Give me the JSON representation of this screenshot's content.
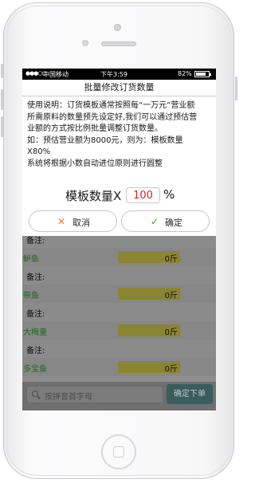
{
  "status_bar": {
    "carrier": "中国移动",
    "time": "下午3:59",
    "battery_percent": "82%",
    "battery_level": 0.82
  },
  "dialog": {
    "title": "批量修改订货数量",
    "instructions": [
      "使用说明：订货模板通常按照每“一万元”营业额",
      "所需原料的数量预先设定好,我们可以通过预估营",
      "业额的方式按比例批量调整订货数量。",
      "如：预估营业额为8000元，则为：模板数量",
      "X80%",
      "系统将根据小数自动进位原则进行圆整"
    ],
    "multiplier_label": "模板数量X",
    "multiplier_value": "100",
    "percent_sign": "%",
    "cancel_label": "取消",
    "confirm_label": "确定"
  },
  "list": {
    "note_label": "备注:",
    "unit": "斤",
    "items": [
      {
        "name": "鲈鱼",
        "qty": "0"
      },
      {
        "name": "带鱼",
        "qty": "0"
      },
      {
        "name": "大梅童",
        "qty": "0"
      },
      {
        "name": "多宝鱼",
        "qty": "0"
      }
    ]
  },
  "bottom_bar": {
    "search_placeholder": "按拼音首字母",
    "confirm_order_label": "确定下单"
  },
  "colors": {
    "item_name": "#1f6b1f",
    "multiplier_value": "#e0201b",
    "cancel_icon": "#e8842a",
    "confirm_icon": "#35a435",
    "confirm_order_bg": "#3b5c5d"
  }
}
